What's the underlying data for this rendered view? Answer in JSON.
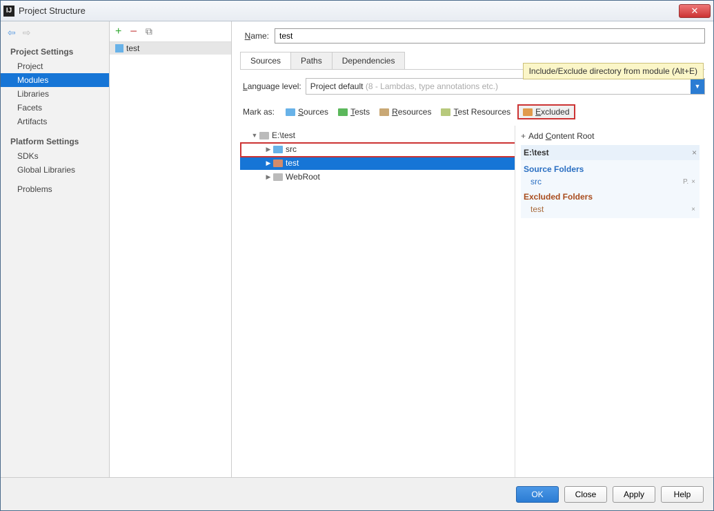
{
  "window": {
    "title": "Project Structure"
  },
  "sidebar": {
    "sections": [
      {
        "title": "Project Settings",
        "items": [
          "Project",
          "Modules",
          "Libraries",
          "Facets",
          "Artifacts"
        ],
        "selected": "Modules"
      },
      {
        "title": "Platform Settings",
        "items": [
          "SDKs",
          "Global Libraries"
        ]
      },
      {
        "title": "",
        "items": [
          "Problems"
        ]
      }
    ]
  },
  "modules": {
    "items": [
      {
        "name": "test"
      }
    ]
  },
  "detail": {
    "name_label": "Name:",
    "name_value": "test",
    "tabs": [
      "Sources",
      "Paths",
      "Dependencies"
    ],
    "active_tab": "Sources",
    "language_label": "Language level:",
    "language_value": "Project default",
    "language_hint": "(8 - Lambdas, type annotations etc.)",
    "tooltip": "Include/Exclude directory from module (Alt+E)",
    "markas_label": "Mark as:",
    "mark_options": [
      {
        "name": "Sources",
        "cls": "ic-sources"
      },
      {
        "name": "Tests",
        "cls": "ic-tests"
      },
      {
        "name": "Resources",
        "cls": "ic-resources"
      },
      {
        "name": "Test Resources",
        "cls": "ic-testres"
      },
      {
        "name": "Excluded",
        "cls": "ic-excluded",
        "highlighted": true
      }
    ],
    "tree": [
      {
        "label": "E:\\test",
        "indent": 1,
        "expanded": true,
        "folder": "plain"
      },
      {
        "label": "src",
        "indent": 2,
        "expanded": false,
        "folder": "src"
      },
      {
        "label": "test",
        "indent": 2,
        "expanded": false,
        "folder": "excl",
        "selected": true
      },
      {
        "label": "WebRoot",
        "indent": 2,
        "expanded": false,
        "folder": "plain"
      }
    ],
    "content_side": {
      "add_label": "Add Content Root",
      "root": "E:\\test",
      "groups": [
        {
          "head": "Source Folders",
          "type": "src",
          "items": [
            {
              "name": "src",
              "suffix": "P"
            }
          ]
        },
        {
          "head": "Excluded Folders",
          "type": "excl",
          "items": [
            {
              "name": "test"
            }
          ]
        }
      ]
    }
  },
  "footer": {
    "ok": "OK",
    "close": "Close",
    "apply": "Apply",
    "help": "Help"
  }
}
